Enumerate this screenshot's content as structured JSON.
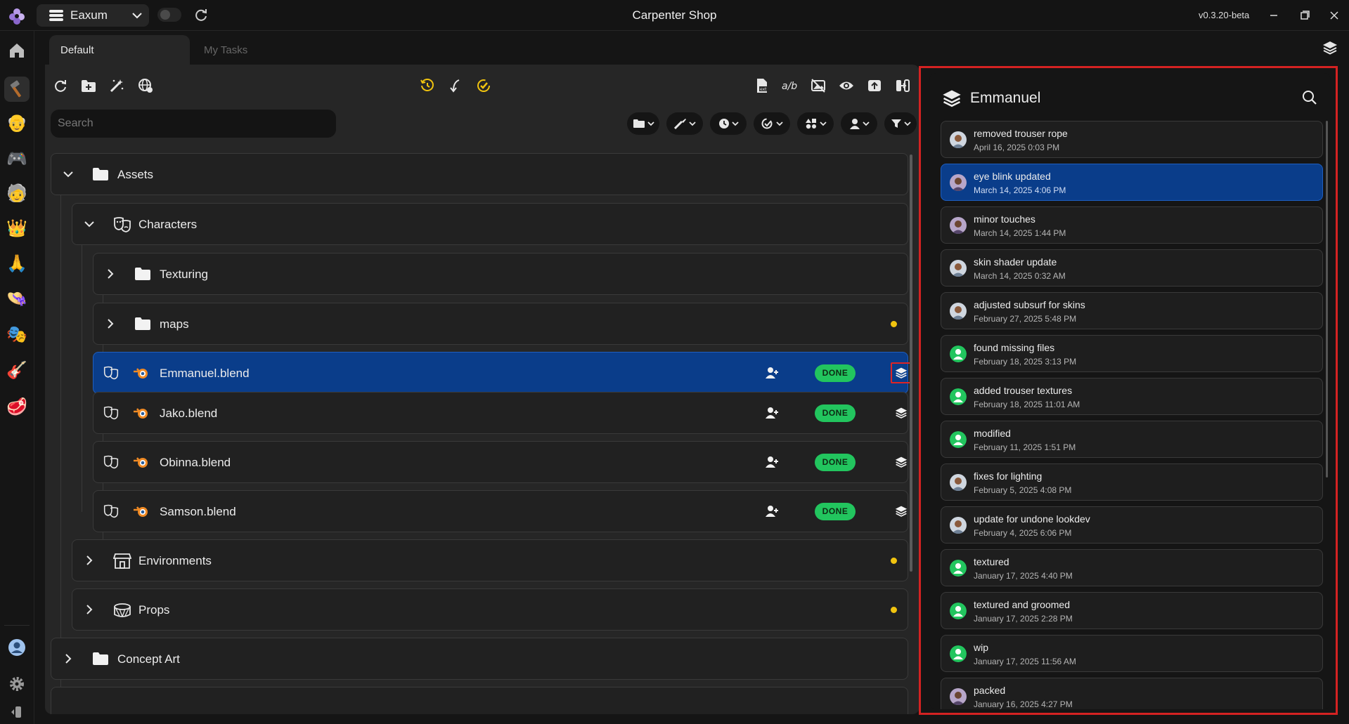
{
  "titlebar": {
    "project_name": "Eaxum",
    "window_title": "Carpenter Shop",
    "version": "v0.3.20-beta"
  },
  "rail": {
    "items": [
      {
        "icon": "home-icon"
      },
      {
        "icon": "hammer-icon",
        "active": true
      },
      {
        "icon": "project-avatar-1-icon"
      },
      {
        "icon": "game-controller-icon"
      },
      {
        "icon": "project-avatar-2-icon"
      },
      {
        "icon": "crown-icon"
      },
      {
        "icon": "praying-hands-icon"
      },
      {
        "icon": "hat-icon"
      },
      {
        "icon": "theater-masks-icon"
      },
      {
        "icon": "guitar-icon"
      },
      {
        "icon": "meat-icon"
      }
    ],
    "bottom": [
      {
        "icon": "user-account-icon"
      },
      {
        "icon": "settings-gear-icon"
      },
      {
        "icon": "collapse-sidebar-icon"
      }
    ]
  },
  "tabs": [
    {
      "label": "Default",
      "active": true
    },
    {
      "label": "My Tasks",
      "active": false
    }
  ],
  "search": {
    "placeholder": "Search"
  },
  "tree": {
    "items": [
      {
        "label": "Assets",
        "type": "folder",
        "expanded": true
      },
      {
        "label": "Characters",
        "type": "category",
        "expanded": true
      },
      {
        "label": "Texturing",
        "type": "folder",
        "expanded": false
      },
      {
        "label": "maps",
        "type": "folder",
        "expanded": false,
        "status_dot": true
      },
      {
        "label": "Emmanuel.blend",
        "type": "blend",
        "status": "DONE",
        "selected": true
      },
      {
        "label": "Jako.blend",
        "type": "blend",
        "status": "DONE"
      },
      {
        "label": "Obinna.blend",
        "type": "blend",
        "status": "DONE"
      },
      {
        "label": "Samson.blend",
        "type": "blend",
        "status": "DONE"
      },
      {
        "label": "Environments",
        "type": "category",
        "expanded": false,
        "status_dot": true
      },
      {
        "label": "Props",
        "type": "category",
        "expanded": false,
        "status_dot": true
      },
      {
        "label": "Concept Art",
        "type": "folder",
        "expanded": false
      }
    ]
  },
  "history": {
    "title": "Emmanuel",
    "versions": [
      {
        "message": "removed trouser rope",
        "date": "April 16, 2025 0:03 PM",
        "avatar": "photo"
      },
      {
        "message": "eye blink updated",
        "date": "March 14, 2025 4:06 PM",
        "avatar": "photo-2",
        "selected": true
      },
      {
        "message": "minor touches",
        "date": "March 14, 2025 1:44 PM",
        "avatar": "photo-2"
      },
      {
        "message": "skin shader update",
        "date": "March 14, 2025 0:32 AM",
        "avatar": "photo"
      },
      {
        "message": "adjusted subsurf for skins",
        "date": "February 27, 2025 5:48 PM",
        "avatar": "photo"
      },
      {
        "message": "found missing files",
        "date": "February 18, 2025 3:13 PM",
        "avatar": "generic"
      },
      {
        "message": "added trouser textures",
        "date": "February 18, 2025 11:01 AM",
        "avatar": "generic"
      },
      {
        "message": "modified",
        "date": "February 11, 2025 1:51 PM",
        "avatar": "generic"
      },
      {
        "message": "fixes for lighting",
        "date": "February 5, 2025 4:08 PM",
        "avatar": "photo"
      },
      {
        "message": "update for undone lookdev",
        "date": "February 4, 2025 6:06 PM",
        "avatar": "photo"
      },
      {
        "message": "textured",
        "date": "January 17, 2025 4:40 PM",
        "avatar": "generic"
      },
      {
        "message": "textured and groomed",
        "date": "January 17, 2025 2:28 PM",
        "avatar": "generic"
      },
      {
        "message": "wip",
        "date": "January 17, 2025 11:56 AM",
        "avatar": "generic"
      },
      {
        "message": "packed",
        "date": "January 16, 2025 4:27 PM",
        "avatar": "photo-2"
      }
    ]
  },
  "colors": {
    "accent_selected": "#0a3d8a",
    "done_badge": "#22c55e",
    "status_dot": "#f1c40f",
    "highlight_border": "#d42222"
  }
}
